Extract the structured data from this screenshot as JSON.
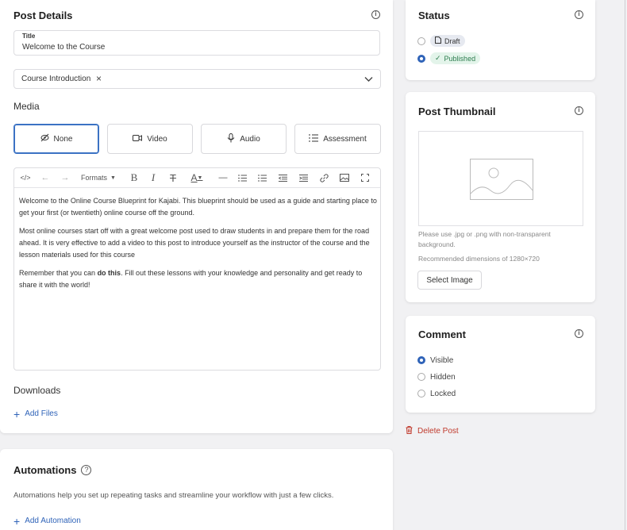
{
  "post_details": {
    "heading": "Post Details",
    "title_label": "Title",
    "title_value": "Welcome to the Course",
    "category_value": "Course Introduction",
    "media_heading": "Media",
    "media_options": [
      "None",
      "Video",
      "Audio",
      "Assessment"
    ],
    "media_selected": "None",
    "toolbar": {
      "formats_label": "Formats"
    },
    "body_paragraphs": [
      "Welcome to the Online Course Blueprint for Kajabi. This blueprint should be used as a guide and starting place to get your first (or twentieth) online course off the ground.",
      "Most online courses start off with a great welcome post used to draw students in and prepare them for the road ahead. It is very effective to add a video to this post to introduce yourself as the instructor of the course and the lesson materials used for this course"
    ],
    "body_p3_pre": "Remember that you can ",
    "body_p3_bold": "do this",
    "body_p3_post": ". Fill out these lessons with your knowledge and personality and get ready to share it with the world!",
    "downloads_heading": "Downloads",
    "add_files": "Add Files"
  },
  "automations": {
    "heading": "Automations",
    "description": "Automations help you set up repeating tasks and streamline your workflow with just a few clicks.",
    "add_automation": "Add Automation"
  },
  "status": {
    "heading": "Status",
    "options": [
      "Draft",
      "Published"
    ],
    "selected": "Published"
  },
  "thumbnail": {
    "heading": "Post Thumbnail",
    "help_text": "Please use .jpg or .png with non-transparent background.",
    "dimensions_text": "Recommended dimensions of 1280×720",
    "select_button": "Select Image"
  },
  "comment": {
    "heading": "Comment",
    "options": [
      "Visible",
      "Hidden",
      "Locked"
    ],
    "selected": "Visible"
  },
  "delete_post": "Delete Post",
  "colors": {
    "accent": "#2f63b8",
    "danger": "#c0392b",
    "published_badge_bg": "#e3f4ea",
    "published_badge_text": "#2e7d4f",
    "draft_badge_bg": "#e6e9f0"
  }
}
